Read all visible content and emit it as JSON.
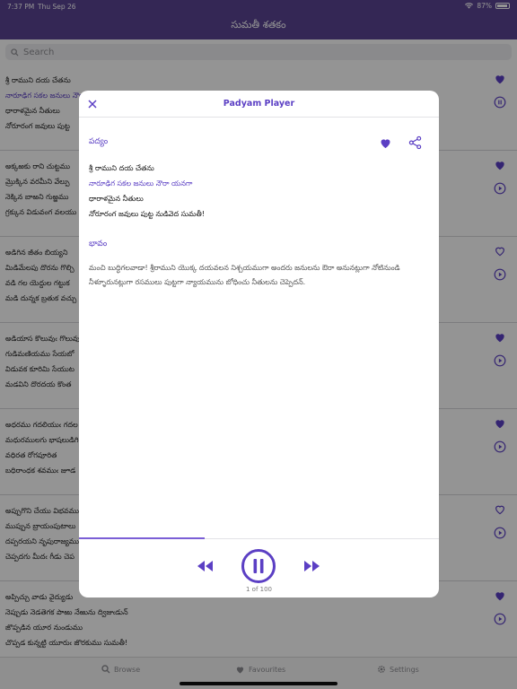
{
  "statusbar": {
    "time": "7:37 PM",
    "date": "Thu Sep 26",
    "battery": "87%"
  },
  "navbar": {
    "title": "సుమతీ శతకం"
  },
  "search": {
    "placeholder": "Search"
  },
  "cards": [
    {
      "lines": [
        "శ్రీ రాముని దయ చేతను",
        "నారూఢిగ సకల జనులు నౌరా",
        "ధారాళమైన నీతులు",
        "నోరూరంగ జవులు పుట్ట"
      ],
      "favorite": true,
      "playing": true
    },
    {
      "lines": [
        "అక్కఱకు రాని చుట్టము",
        "మ్రొక్కిన వరమీని వేల్పు",
        "నెక్కిన బాఱని గుఱ్ఱము",
        "గ్రక్కున విడువంగ వలయు"
      ],
      "favorite": true,
      "playing": false
    },
    {
      "lines": [
        "అడిగిన జీతం బియ్యని",
        "మిడిమేలపు దొరను గొల్చి",
        "వడి గల యెద్దుల గట్టుక",
        "మడి దున్నక బ్రతుక వచ్చు"
      ],
      "favorite": false,
      "playing": false
    },
    {
      "lines": [
        "అడియాస కొలువుఁ గొలువుఁ",
        "గుడిమణియము సేయబో",
        "విడువక కూరిమి సేయుట",
        "మడవిని దొరదయ కొంత"
      ],
      "favorite": true,
      "playing": false
    },
    {
      "lines": [
        "అధరము గదలియుఁ గదల",
        "మధురములగు భాషలుడిగి",
        "వధిరత రోగపూరిత",
        "బధిరాంధక శవముఁ జూడ"
      ],
      "favorite": true,
      "playing": false
    },
    {
      "lines": [
        "అప్పుగొని చేయు విభవము",
        "ముప్పున బ్రాయంపుటాలు",
        "దప్పరయని నృపురాజ్యము",
        "చెప్పదగు మీదఁ గీడు చెప"
      ],
      "favorite": false,
      "playing": false
    },
    {
      "lines": [
        "అప్పిచ్చు వాడు వైద్యుడు",
        "నెప్పుడు నెడతెగక పాఱు నేఱును ద్విజుఁడున్",
        "జొప్పడిన యూర నుండుము",
        "చొప్పడ కున్నట్టి యూరుఁ జొరకుము సుమతీ!"
      ],
      "favorite": true,
      "playing": false
    }
  ],
  "tabs": [
    {
      "label": "Browse",
      "icon": "search-icon"
    },
    {
      "label": "Favourites",
      "icon": "heart-icon"
    },
    {
      "label": "Settings",
      "icon": "gear-icon"
    }
  ],
  "modal": {
    "title": "Padyam Player",
    "padyam_label": "పద్యం",
    "bhavam_label": "భావం",
    "verse": [
      "శ్రీ రాముని దయ చేతను",
      "నారూఢిగ సకల జనులు నౌరా యనగా",
      "ధారాళమైన నీతులు",
      "నోరూరంగ జవులు పుట్ట నుడివెద సుమతీ!"
    ],
    "meaning": "మంచి బుద్ధిగలవాడా! శ్రీరాముని యొక్క దయవలన నిశ్చయముగా అందరు జనులను ఔరా అనునట్లుగా నోటినుండి నీళ్ళూరునట్లుగా రసములు పుట్టగా న్యాయమును బోధించు నీతులను చెప్పెదన్.",
    "favorite": true,
    "progress": 0.35,
    "counter": "1 of 100"
  },
  "colors": {
    "brand": "#5a4493",
    "accent": "#5b3fc4",
    "fill": "#7b5fd6"
  }
}
